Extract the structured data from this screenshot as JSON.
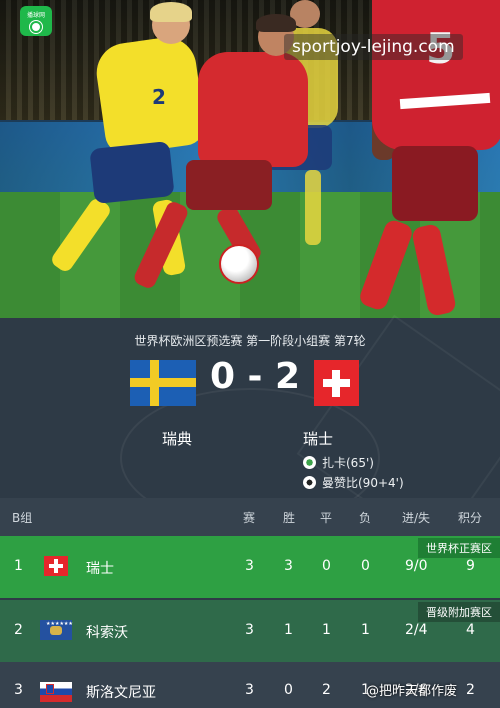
{
  "photo": {
    "app_badge_label": "播球网",
    "watermark": "sportjoy-lejing.com",
    "yellow_number": "2",
    "red_number": "5"
  },
  "match": {
    "stage": "世界杯欧洲区预选赛 第一阶段小组赛 第7轮",
    "home_team": "瑞典",
    "away_team": "瑞士",
    "score": "0 - 2",
    "scorers": [
      {
        "text": "扎卡(65')",
        "icon": "goal-ball-icon"
      },
      {
        "text": "曼赞比(90+4')",
        "icon": "goal-ball-icon"
      }
    ]
  },
  "standings": {
    "group": "B组",
    "columns": [
      "赛",
      "胜",
      "平",
      "负",
      "进/失",
      "积分"
    ],
    "rows": [
      {
        "rank": "1",
        "team": "瑞士",
        "played": "3",
        "won": "3",
        "drawn": "0",
        "lost": "0",
        "goals": "9/0",
        "points": "9",
        "tag": "世界杯正赛区"
      },
      {
        "rank": "2",
        "team": "科索沃",
        "played": "3",
        "won": "1",
        "drawn": "1",
        "lost": "1",
        "goals": "2/4",
        "points": "4",
        "tag": "晋级附加赛区"
      },
      {
        "rank": "3",
        "team": "斯洛文尼亚",
        "played": "3",
        "won": "0",
        "drawn": "2",
        "lost": "1",
        "goals": "2/6",
        "points": "2",
        "tag": ""
      }
    ]
  },
  "watermark_bottom": "@把昨天都作废",
  "colors": {
    "qualify_green": "#2ea043",
    "playoff_green": "#2f6a4a",
    "background": "#2e3a46"
  }
}
